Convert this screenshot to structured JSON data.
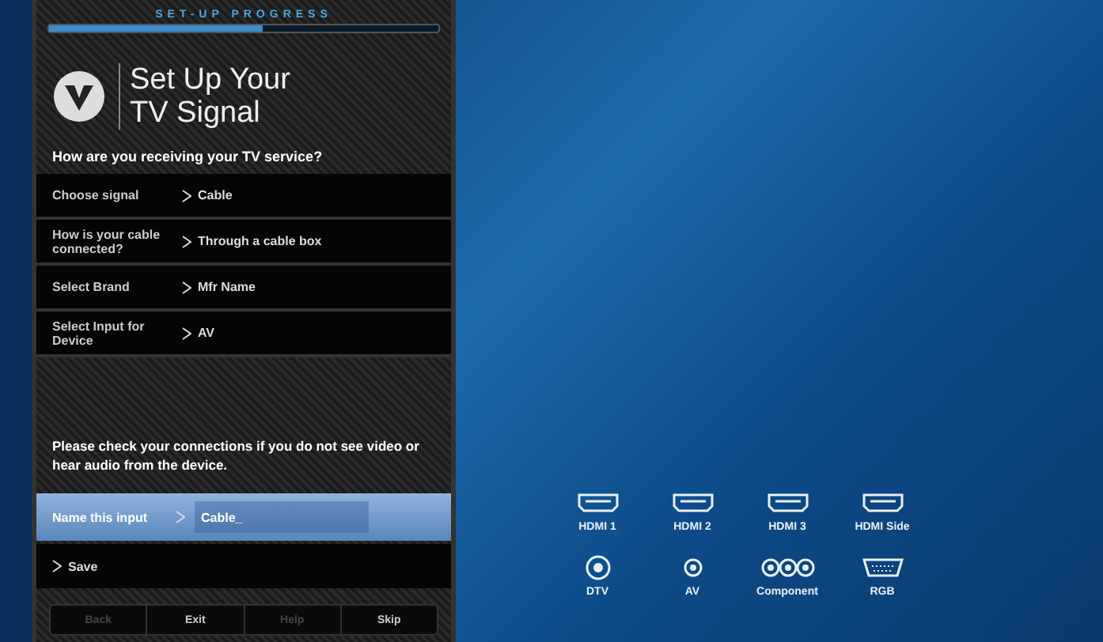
{
  "progress": {
    "label": "SET-UP PROGRESS",
    "level": 0.55
  },
  "title": [
    "Set Up Your",
    "TV Signal"
  ],
  "question": "How are you receiving your TV service?",
  "rows": [
    {
      "label": "Choose signal",
      "value": "Cable"
    },
    {
      "label": "How is your cable connected?",
      "value": "Through a cable box"
    },
    {
      "label": "Select Brand",
      "value": "Mfr Name"
    },
    {
      "label": "Select Input for Device",
      "value": "AV"
    }
  ],
  "notice": "Please check your connections if you do not see video or hear audio from the device.",
  "name_input": {
    "label": "Name this input",
    "value": "Cable_",
    "selected": true
  },
  "save": {
    "label": "Save",
    "selected": false
  },
  "buttons": [
    {
      "label": "Back",
      "disabled": true
    },
    {
      "label": "Exit",
      "disabled": false
    },
    {
      "label": "Help",
      "disabled": true
    },
    {
      "label": "Skip",
      "disabled": false
    }
  ],
  "ports": [
    {
      "label": "HDMI 1",
      "kind": "hdmi"
    },
    {
      "label": "HDMI 2",
      "kind": "hdmi"
    },
    {
      "label": "HDMI 3",
      "kind": "hdmi"
    },
    {
      "label": "HDMI Side",
      "kind": "hdmi"
    },
    {
      "label": "DTV",
      "kind": "coax"
    },
    {
      "label": "AV",
      "kind": "rca"
    },
    {
      "label": "Component",
      "kind": "component"
    },
    {
      "label": "RGB",
      "kind": "vga"
    }
  ]
}
